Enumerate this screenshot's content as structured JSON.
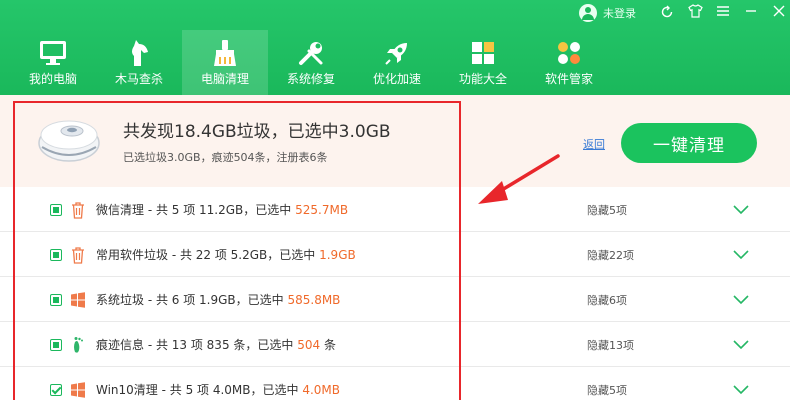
{
  "titlebar": {
    "login_label": "未登录"
  },
  "nav": {
    "items": [
      {
        "label": "我的电脑",
        "icon": "monitor-icon",
        "active": false
      },
      {
        "label": "木马查杀",
        "icon": "horse-icon",
        "active": false
      },
      {
        "label": "电脑清理",
        "icon": "broom-icon",
        "active": true
      },
      {
        "label": "系统修复",
        "icon": "wrench-icon",
        "active": false
      },
      {
        "label": "优化加速",
        "icon": "rocket-icon",
        "active": false
      },
      {
        "label": "功能大全",
        "icon": "grid-icon",
        "active": false
      },
      {
        "label": "软件管家",
        "icon": "apps-icon",
        "active": false
      }
    ]
  },
  "summary": {
    "title": "共发现18.4GB垃圾，已选中3.0GB",
    "subtitle": "已选垃圾3.0GB，痕迹504条，注册表6条",
    "back_label": "返回",
    "clean_button": "一键清理"
  },
  "rows": [
    {
      "prefix": "微信清理 - 共 5 项 11.2GB，已选中 ",
      "highlight": "525.7MB",
      "hidden": "隐藏5项",
      "icon": "trash-icon",
      "check": "partial"
    },
    {
      "prefix": "常用软件垃圾 - 共 22 项 5.2GB，已选中 ",
      "highlight": "1.9GB",
      "hidden": "隐藏22项",
      "icon": "trash-icon",
      "check": "partial"
    },
    {
      "prefix": "系统垃圾 - 共 6 项 1.9GB，已选中 ",
      "highlight": "585.8MB",
      "hidden": "隐藏6项",
      "icon": "windows-icon",
      "check": "partial"
    },
    {
      "prefix": "痕迹信息 - 共 13 项 835 条，已选中 ",
      "highlight": "504",
      "suffix": " 条",
      "hidden": "隐藏13项",
      "icon": "footprint-icon",
      "check": "partial"
    },
    {
      "prefix": "Win10清理 - 共 5 项 4.0MB，已选中 ",
      "highlight": "4.0MB",
      "hidden": "隐藏5项",
      "icon": "windows-icon",
      "check": "checked"
    }
  ],
  "colors": {
    "brand_green": "#1bc35e",
    "highlight_orange": "#f06a2b",
    "annotation_red": "#e8262b"
  }
}
